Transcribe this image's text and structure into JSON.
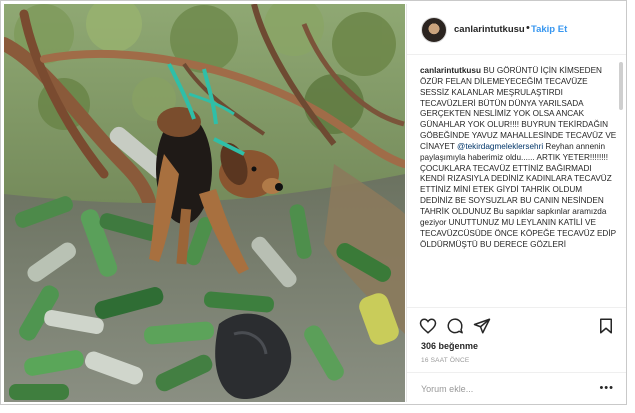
{
  "post": {
    "username": "canlarintutkusu",
    "separator": "•",
    "follow_label": "Takip Et",
    "caption_user": "canlarintutkusu",
    "caption_text_1": " BU GÖRÜNTÜ İÇİN KİMSEDEN ÖZÜR FELAN DİLEMEYECEĞİM TECAVÜZE SESSİZ KALANLAR MEŞRULAŞTIRDI TECAVÜZLERİ BÜTÜN DÜNYA YARILSADA GERÇEKTEN NESLİMİZ YOK OLSA ANCAK GÜNAHLAR YOK OLUR!!!! BUYRUN TEKİRDAĞIN GÖBEĞİNDE YAVUZ MAHALLESİNDE TECAVÜZ VE CİNAYET ",
    "caption_mention": "@tekirdagmeleklersehri",
    "caption_text_2": " Reyhan annenin paylaşımıyla haberimiz oldu...... ARTIK YETER!!!!!!!! ÇOCUKLARA TECAVÜZ ETTİNİZ BAĞIRMADI KENDİ RIZASIYLA DEDİNİZ KADINLARA TECAVÜZ ETTİNİZ MİNİ ETEK GİYDİ TAHRİK OLDUM DEDİNİZ BE SOYSUZLAR BU CANIN NESİNDEN TAHRİK OLDUNUZ Bu sapıklar sapkınlar aramızda geziyor UNUTTUNUZ MU LEYLANIN KATİLİ VE TECAVÜZCÜSÜDE ÖNCE KÖPEĞE TECAVÜZ EDİP ÖLDÜRMÜŞTÜ BU DERECE GÖZLERİ",
    "likes": "306 beğenme",
    "time": "16 SAAT ÖNCE",
    "comment_placeholder": "Yorum ekle...",
    "more_options": "•••"
  },
  "icons": {
    "like": "heart-icon",
    "comment": "comment-bubble-icon",
    "share": "paper-plane-icon",
    "save": "bookmark-icon"
  },
  "colors": {
    "link": "#3897f0",
    "text": "#262626",
    "muted": "#999999"
  }
}
